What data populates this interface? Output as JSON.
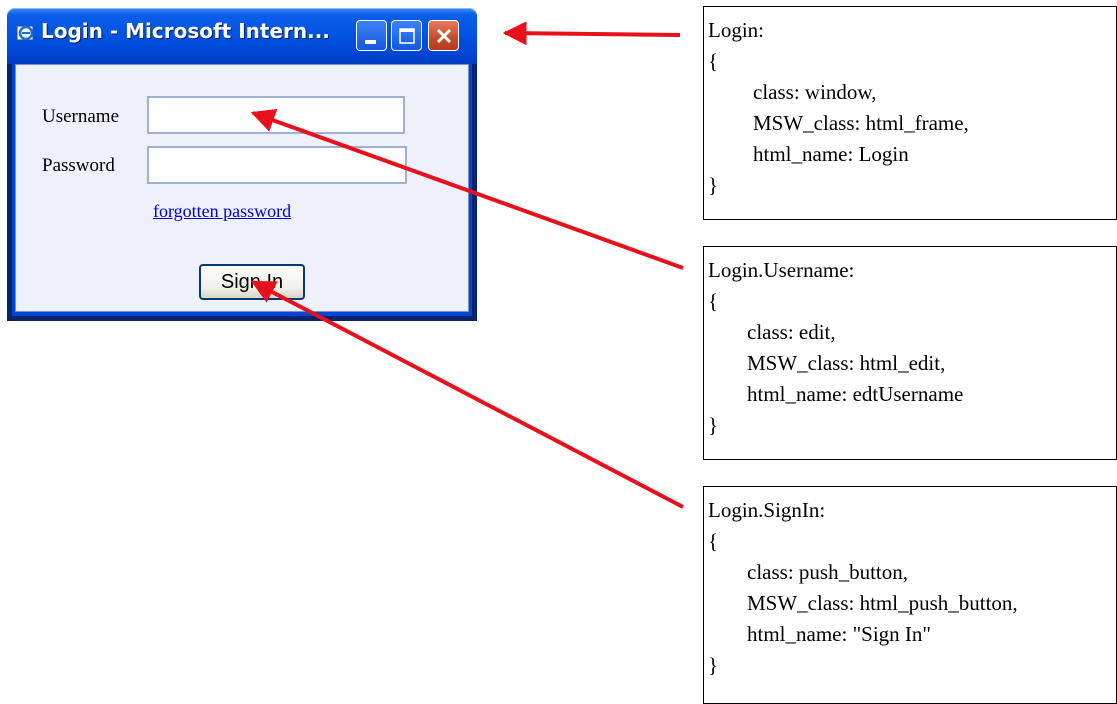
{
  "window": {
    "title": "Login - Microsoft Intern...",
    "minimize_label": "minimize",
    "maximize_label": "maximize",
    "close_label": "close"
  },
  "form": {
    "username_label": "Username",
    "username_value": "",
    "password_label": "Password",
    "password_value": "",
    "forgot_link": "forgotten password",
    "signin_label": "Sign In"
  },
  "annotations": [
    {
      "header": "Login:",
      "open": "{",
      "lines": [
        "class: window,",
        "MSW_class: html_frame,",
        "html_name: Login"
      ],
      "close": "}"
    },
    {
      "header": "Login.Username:",
      "open": "{",
      "lines": [
        "class: edit,",
        "MSW_class: html_edit,",
        "html_name: edtUsername"
      ],
      "close": "}"
    },
    {
      "header": "Login.SignIn:",
      "open": "{",
      "lines": [
        "class: push_button,",
        "MSW_class: html_push_button,",
        "html_name: \"Sign In\""
      ],
      "close": "}"
    }
  ],
  "colors": {
    "arrow": "#e8101a",
    "titlebar": "#0055e5",
    "client_bg": "#eef0fc",
    "link": "#0000cc"
  }
}
